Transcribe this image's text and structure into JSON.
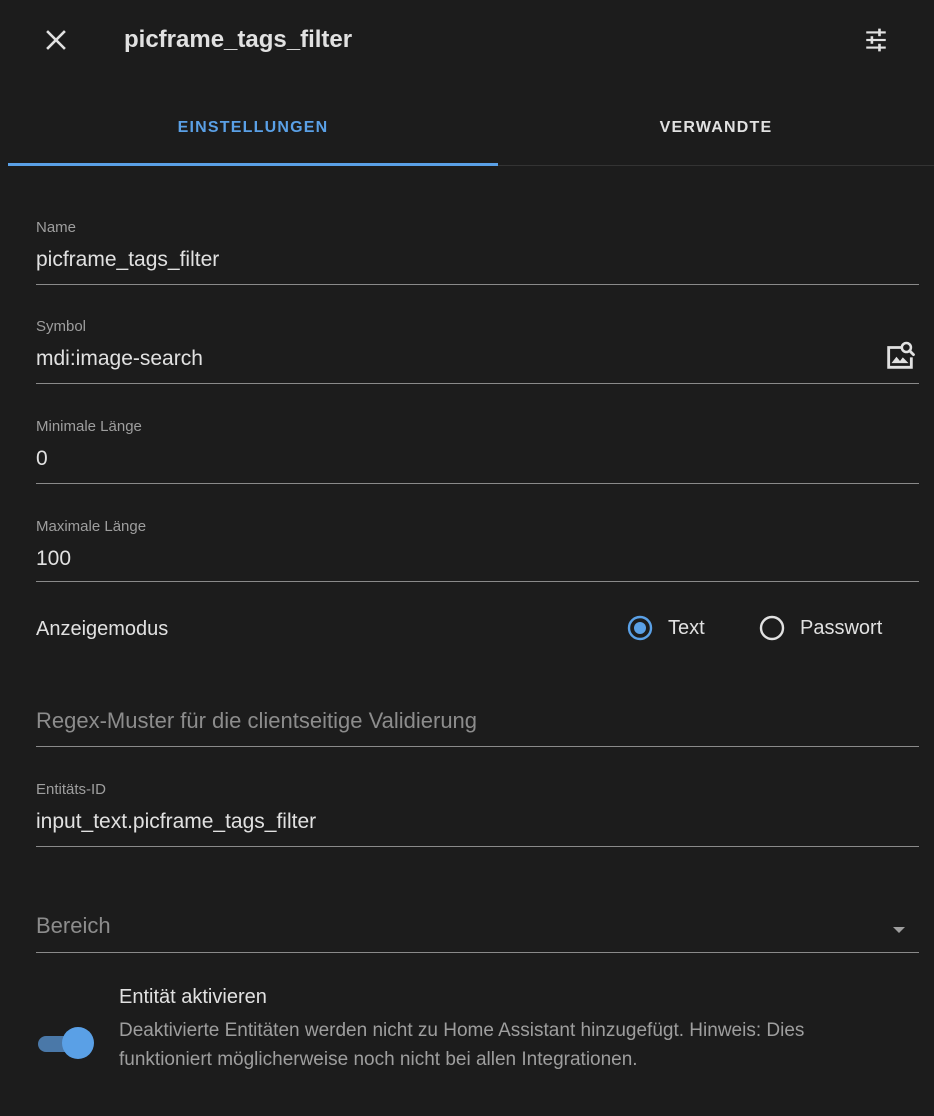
{
  "header": {
    "title": "picframe_tags_filter",
    "close_icon": "close-icon",
    "settings_icon": "tune-icon"
  },
  "tabs": [
    {
      "label": "EINSTELLUNGEN",
      "active": true
    },
    {
      "label": "VERWANDTE",
      "active": false
    }
  ],
  "form": {
    "name": {
      "label": "Name",
      "value": "picframe_tags_filter"
    },
    "symbol": {
      "label": "Symbol",
      "value": "mdi:image-search",
      "icon": "image-search-icon"
    },
    "min_length": {
      "label": "Minimale Länge",
      "value": "0"
    },
    "max_length": {
      "label": "Maximale Länge",
      "value": "100"
    },
    "display_mode": {
      "label": "Anzeigemodus",
      "options": [
        {
          "label": "Text",
          "selected": true
        },
        {
          "label": "Passwort",
          "selected": false
        }
      ]
    },
    "regex": {
      "placeholder": "Regex-Muster für die clientseitige Validierung"
    },
    "entity_id": {
      "label": "Entitäts-ID",
      "value": "input_text.picframe_tags_filter"
    },
    "area": {
      "placeholder": "Bereich",
      "icon": "dropdown-icon"
    }
  },
  "enable": {
    "title": "Entität aktivieren",
    "description": "Deaktivierte Entitäten werden nicht zu Home Assistant hinzugefügt. Hinweis: Dies funktioniert möglicherweise noch nicht bei allen Integrationen.",
    "enabled": true
  },
  "colors": {
    "background": "#1c1c1c",
    "accent": "#5aa0e6",
    "text": "#e1e1e1",
    "secondary_text": "#9e9e9e"
  }
}
